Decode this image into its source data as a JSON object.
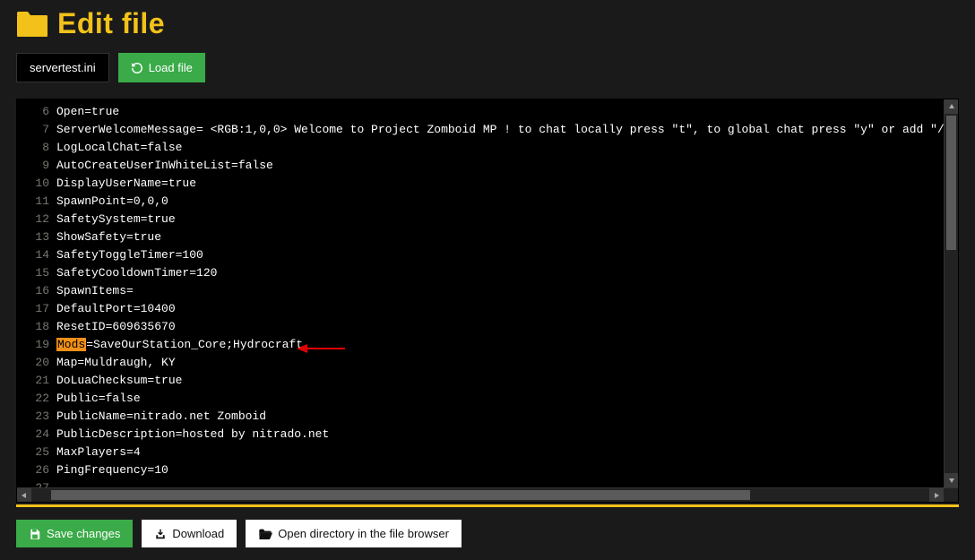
{
  "header": {
    "title": "Edit file"
  },
  "toolbar": {
    "filename": "servertest.ini",
    "load_label": "Load file"
  },
  "editor": {
    "first_line_number": 6,
    "highlight_line_index": 13,
    "highlight_token": "Mods",
    "highlight_rest": "=SaveOurStation_Core;Hydrocraft",
    "lines": [
      "Open=true",
      "ServerWelcomeMessage= <RGB:1,0,0> Welcome to Project Zomboid MP ! to chat locally press \"t\", to global chat press \"y\" or add \"/all\"",
      "LogLocalChat=false",
      "AutoCreateUserInWhiteList=false",
      "DisplayUserName=true",
      "SpawnPoint=0,0,0",
      "SafetySystem=true",
      "ShowSafety=true",
      "SafetyToggleTimer=100",
      "SafetyCooldownTimer=120",
      "SpawnItems=",
      "DefaultPort=10400",
      "ResetID=609635670",
      "Mods=SaveOurStation_Core;Hydrocraft",
      "Map=Muldraugh, KY",
      "DoLuaChecksum=true",
      "Public=false",
      "PublicName=nitrado.net Zomboid",
      "PublicDescription=hosted by nitrado.net",
      "MaxPlayers=4",
      "PingFrequency=10",
      ""
    ]
  },
  "footer": {
    "save_label": "Save changes",
    "download_label": "Download",
    "open_dir_label": "Open directory in the file browser"
  },
  "colors": {
    "accent": "#f2c21a",
    "green": "#3aab48",
    "highlight": "#f29018",
    "arrow": "#e10000"
  }
}
